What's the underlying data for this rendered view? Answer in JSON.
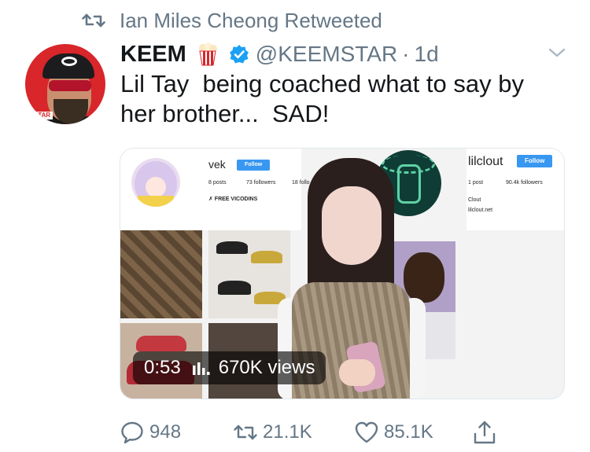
{
  "retweet_banner": {
    "text": "Ian Miles Cheong Retweeted",
    "icon": "retweet-icon"
  },
  "author": {
    "name": "KEEM",
    "handle": "@KEEMSTAR",
    "separator": "·",
    "time": "1d",
    "avatar_badge": "STAR",
    "emoji_icon": "popcorn-icon",
    "verified_icon": "verified-badge-icon"
  },
  "tweet": {
    "text": "Lil Tay  being coached what to say by\nher brother...  SAD!"
  },
  "media": {
    "duration": "0:53",
    "views": "670K views",
    "vek_profile": {
      "username": "vek",
      "follow": "Follow",
      "posts": "8 posts",
      "followers": "73 followers",
      "following": "18 follo",
      "bio": "✗ FREE VICODINS"
    },
    "lil_profile": {
      "username": "lilclout",
      "follow": "Follow",
      "posts": "1 post",
      "followers": "90.4k followers",
      "bio_name": "Clout",
      "bio_link": "lilclout.net"
    }
  },
  "actions": {
    "reply_count": "948",
    "retweet_count": "21.1K",
    "like_count": "85.1K"
  },
  "colors": {
    "text": "#14171a",
    "secondary": "#657786",
    "verified": "#1da1f2",
    "avatar_bg": "#d8262b"
  }
}
